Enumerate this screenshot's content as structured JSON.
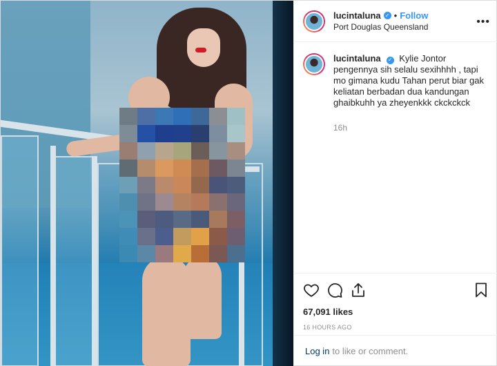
{
  "header": {
    "username": "lucintaluna",
    "separator": "•",
    "follow_label": "Follow",
    "location": "Port Douglas Queensland",
    "more_label": "•••"
  },
  "caption": {
    "username": "lucintaluna",
    "text": "Kylie Jontor pengennya sih selalu sexihhhh , tapi mo gimana kudu Tahan perut biar gak keliatan berbadan dua kandungan ghaibkuhh ya zheyenkkk ckckckck",
    "time": "16h"
  },
  "actions": {
    "icons": [
      "heart-icon",
      "comment-icon",
      "share-icon",
      "bookmark-icon"
    ],
    "likes": "67,091 likes",
    "timestamp": "16 HOURS AGO"
  },
  "footer": {
    "login_label": "Log in",
    "rest_label": "to like or comment."
  },
  "colors": {
    "accent": "#3897f0",
    "link_dark": "#003569",
    "verified": "#3897f0",
    "muted": "#8e8e8e"
  }
}
